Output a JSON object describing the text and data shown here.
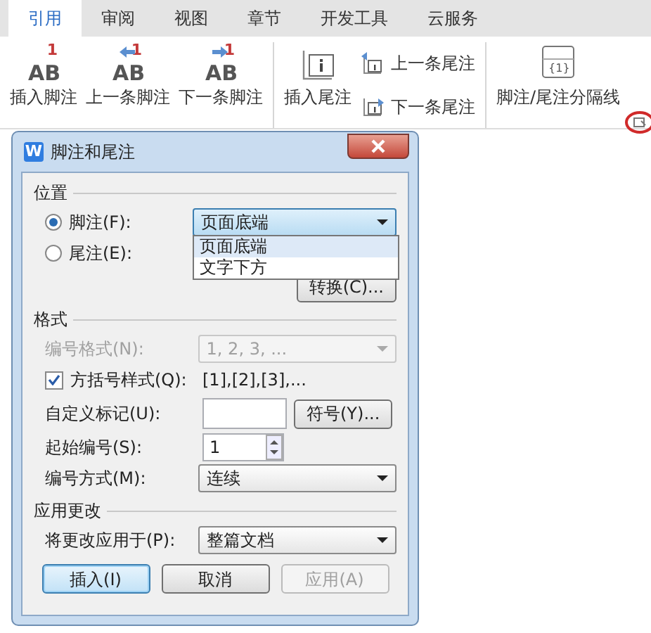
{
  "ribbon": {
    "tabs": [
      {
        "label": "引用",
        "selected": true
      },
      {
        "label": "审阅",
        "selected": false
      },
      {
        "label": "视图",
        "selected": false
      },
      {
        "label": "章节",
        "selected": false
      },
      {
        "label": "开发工具",
        "selected": false
      },
      {
        "label": "云服务",
        "selected": false
      }
    ],
    "groups": [
      {
        "buttons": [
          {
            "kind": "footnote",
            "label": "插入脚注",
            "icon_text": "AB",
            "icon_badge": "1"
          },
          {
            "kind": "footnote-prev",
            "label": "上一条脚注",
            "icon_text": "AB",
            "icon_badge": "1"
          },
          {
            "kind": "footnote-next",
            "label": "下一条脚注",
            "icon_text": "AB",
            "icon_badge": "1"
          }
        ]
      },
      {
        "buttons": [
          {
            "kind": "endnote",
            "label": "插入尾注"
          },
          {
            "kind": "small-prev",
            "label": "上一条尾注"
          },
          {
            "kind": "small-next",
            "label": "下一条尾注"
          }
        ]
      },
      {
        "buttons": [
          {
            "kind": "separator",
            "label": "脚注/尾注分隔线",
            "icon_text": "{1}"
          }
        ]
      }
    ]
  },
  "dialog": {
    "logo_text": "W",
    "title": "脚注和尾注",
    "sections": [
      {
        "title": "位置",
        "rows": [
          {
            "kind": "radio",
            "label": "脚注(F):",
            "selected": true,
            "select": {
              "value": "页面底端",
              "open": true,
              "options": [
                {
                  "label": "页面底端",
                  "selected": true
                },
                {
                  "label": "文字下方",
                  "selected": false
                }
              ]
            }
          },
          {
            "kind": "radio",
            "label": "尾注(E):",
            "selected": false
          },
          {
            "kind": "buttononly",
            "button": "转换(C)..."
          }
        ]
      },
      {
        "title": "格式",
        "rows": [
          {
            "kind": "label",
            "label": "编号格式(N):",
            "disabled": true,
            "select": {
              "value": "1, 2, 3, ..."
            }
          },
          {
            "kind": "checkbox",
            "label": "方括号样式(Q):",
            "checked": true,
            "text": "[1],[2],[3],..."
          },
          {
            "kind": "label",
            "label": "自定义标记(U):",
            "input": "",
            "button": "符号(Y)..."
          },
          {
            "kind": "label",
            "label": "起始编号(S):",
            "spinner": "1"
          },
          {
            "kind": "label",
            "label": "编号方式(M):",
            "select": {
              "value": "连续"
            }
          }
        ]
      },
      {
        "title": "应用更改",
        "rows": [
          {
            "kind": "label",
            "label": "将更改应用于(P):",
            "select": {
              "value": "整篇文档"
            }
          }
        ]
      }
    ],
    "buttons": [
      {
        "label": "插入(I)",
        "default": true,
        "disabled": false
      },
      {
        "label": "取消",
        "default": false,
        "disabled": false
      },
      {
        "label": "应用(A)",
        "default": false,
        "disabled": true
      }
    ]
  }
}
